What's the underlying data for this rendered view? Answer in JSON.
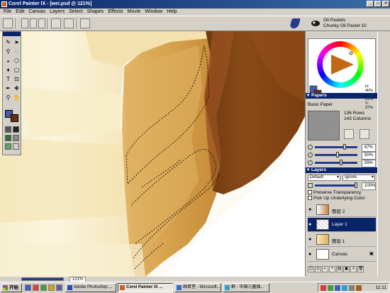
{
  "window": {
    "title": "Corel Painter IX - [wei.psd @ 121%]"
  },
  "window_buttons": {
    "minimize": "_",
    "maximize": "□",
    "close": "×"
  },
  "menu": [
    "File",
    "Edit",
    "Canvas",
    "Layers",
    "Select",
    "Shapes",
    "Effects",
    "Movie",
    "Window",
    "Help"
  ],
  "brush": {
    "category": "Oil Pastels",
    "variant": "Chunky Oil Pastel 10"
  },
  "color_panel": {
    "hsv": [
      "H: 40%",
      "S: 81%",
      "V: 37%"
    ],
    "main_color": "#4a5aa0",
    "additional_color": "#6a3010"
  },
  "papers": {
    "title": "Papers",
    "name": "Basic Paper",
    "rows": "136 Rows",
    "columns": "143 Columns",
    "sliders": [
      {
        "value": "67%",
        "level": 0.67
      },
      {
        "value": "50%",
        "level": 0.5
      },
      {
        "value": "59%",
        "level": 0.59
      }
    ]
  },
  "layers": {
    "title": "Layers",
    "composite_method": "Default",
    "composite_depth": "Ignore",
    "opacity": "100%",
    "preserve_transparency": "Preserve Transparency",
    "pick_up_color": "Pick Up Underlying Color",
    "items": [
      {
        "name": "图层 2",
        "selected": false
      },
      {
        "name": "Layer 1",
        "selected": true
      },
      {
        "name": "图层 1",
        "selected": false
      },
      {
        "name": "Canvas",
        "selected": false
      }
    ]
  },
  "status": {
    "zoom": "121%"
  },
  "taskbar": {
    "start": "开始",
    "tasks": [
      {
        "label": "Adobe Photoshop ...",
        "active": false
      },
      {
        "label": "Corel Painter IX ...",
        "active": true
      },
      {
        "label": "画目堂 - Microsoft...",
        "active": false
      },
      {
        "label": "群 - 中国儿童插...",
        "active": false
      }
    ],
    "clock": "11:11"
  }
}
